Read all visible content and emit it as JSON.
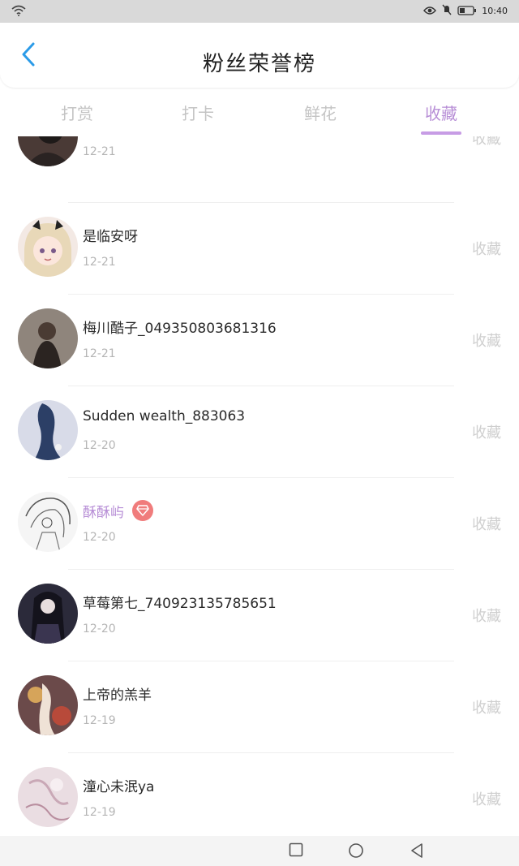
{
  "status_bar": {
    "time": "10:40",
    "icons": [
      "wifi-icon",
      "eye-icon",
      "mute-icon",
      "battery-icon"
    ]
  },
  "header": {
    "title": "粉丝荣誉榜",
    "back_icon": "chevron-left-icon"
  },
  "tabs": [
    {
      "label": "打赏",
      "active": false
    },
    {
      "label": "打卡",
      "active": false
    },
    {
      "label": "鲜花",
      "active": false
    },
    {
      "label": "收藏",
      "active": true
    }
  ],
  "colors": {
    "accent": "#b78ed6",
    "badge": "#f07c7c",
    "tab_inactive": "#c4c4c4",
    "action": "#cfcfcf"
  },
  "list": {
    "items": [
      {
        "name": "",
        "date": "12-21",
        "action": "收藏",
        "vip": false
      },
      {
        "name": "是临安呀",
        "date": "12-21",
        "action": "收藏",
        "vip": false
      },
      {
        "name": "梅川酷子_049350803681316",
        "date": "12-21",
        "action": "收藏",
        "vip": false
      },
      {
        "name": "Sudden wealth_883063",
        "date": "12-20",
        "action": "收藏",
        "vip": false
      },
      {
        "name": "酥酥屿",
        "date": "12-20",
        "action": "收藏",
        "vip": true,
        "badge_icon": "diamond-icon"
      },
      {
        "name": "草莓第七_740923135785651",
        "date": "12-20",
        "action": "收藏",
        "vip": false
      },
      {
        "name": "上帝的羔羊",
        "date": "12-19",
        "action": "收藏",
        "vip": false
      },
      {
        "name": "潼心未泯ya",
        "date": "12-19",
        "action": "收藏",
        "vip": false
      }
    ]
  },
  "nav_bar": {
    "icons": [
      "recents-square-icon",
      "home-circle-icon",
      "back-triangle-icon"
    ]
  }
}
